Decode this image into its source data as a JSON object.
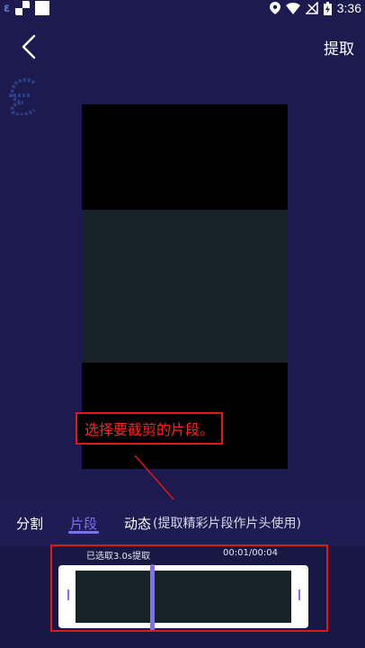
{
  "status_bar": {
    "time": "3:36",
    "icons": [
      "app-e-icon",
      "checker-notification-icon",
      "blank-notification-icon",
      "location-icon",
      "wifi-icon",
      "no-signal-icon",
      "battery-charging-icon"
    ]
  },
  "header": {
    "back_icon": "chevron-left-icon",
    "extract_label": "提取"
  },
  "annotation": {
    "text": "选择要截剪的片段。",
    "color": "#ff2020"
  },
  "tabs": {
    "items": [
      {
        "label": "分割",
        "active": false
      },
      {
        "label": "片段",
        "active": true
      },
      {
        "label": "动态",
        "active": false
      }
    ],
    "hint": "(提取精彩片段作片头使用)",
    "accent": "#7f6ef6"
  },
  "timeline": {
    "selected_label": "已选取3.0s提取",
    "time_label": "00:01/00:04"
  },
  "colors": {
    "background": "#1c1a4e",
    "accent": "#7f6ef6",
    "annotation_red": "#e01818"
  }
}
